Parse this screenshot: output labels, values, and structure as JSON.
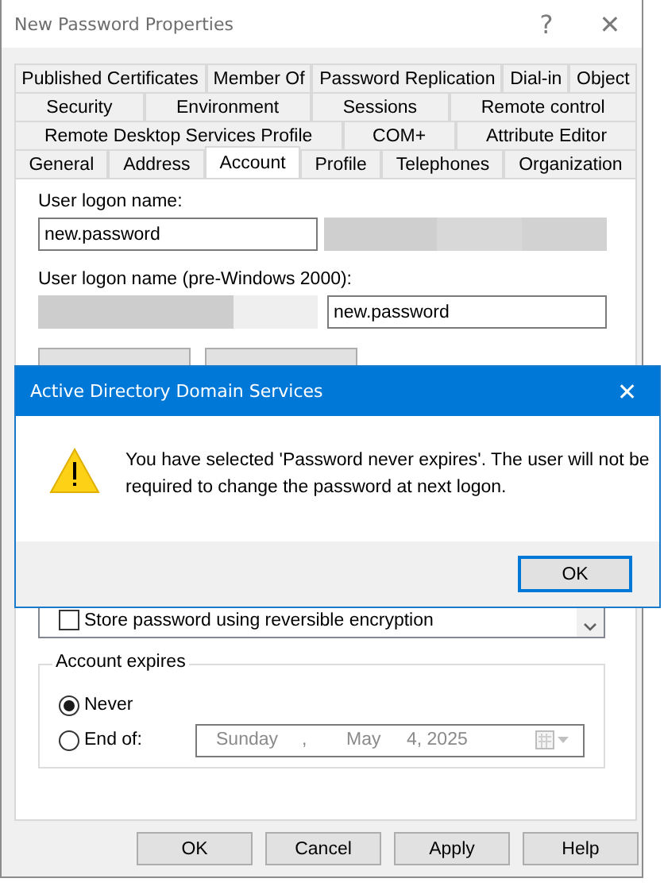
{
  "window": {
    "title": "New Password Properties",
    "help": "?",
    "close": "✕"
  },
  "tab_rows": [
    [
      {
        "label": "Published Certificates",
        "selected": false
      },
      {
        "label": "Member Of",
        "selected": false
      },
      {
        "label": "Password Replication",
        "selected": false
      },
      {
        "label": "Dial-in",
        "selected": false
      },
      {
        "label": "Object",
        "selected": false
      }
    ],
    [
      {
        "label": "Security",
        "selected": false
      },
      {
        "label": "Environment",
        "selected": false
      },
      {
        "label": "Sessions",
        "selected": false
      },
      {
        "label": "Remote control",
        "selected": false
      }
    ],
    [
      {
        "label": "Remote Desktop Services Profile",
        "selected": false
      },
      {
        "label": "COM+",
        "selected": false
      },
      {
        "label": "Attribute Editor",
        "selected": false
      }
    ],
    [
      {
        "label": "General",
        "selected": false
      },
      {
        "label": "Address",
        "selected": false
      },
      {
        "label": "Account",
        "selected": true
      },
      {
        "label": "Profile",
        "selected": false
      },
      {
        "label": "Telephones",
        "selected": false
      },
      {
        "label": "Organization",
        "selected": false
      }
    ]
  ],
  "account": {
    "logon_name_label": "User logon name:",
    "logon_name": "new.password",
    "pre2000_label": "User logon name (pre-Windows 2000):",
    "pre2000_name": "new.password",
    "account_options": [
      {
        "label": "Store password using reversible encryption",
        "checked": false
      }
    ],
    "expires_label": "Account expires",
    "expires": [
      {
        "label": "Never",
        "selected": true
      },
      {
        "label": "End of:",
        "selected": false
      }
    ],
    "date_picker": {
      "weekday": "Sunday",
      "separator": ",",
      "month": "May",
      "day_year": "4, 2025",
      "disabled": true
    }
  },
  "buttons": [
    "OK",
    "Cancel",
    "Apply",
    "Help"
  ],
  "message_box": {
    "title": "Active Directory Domain Services",
    "close": "✕",
    "message": "You have selected 'Password never expires'. The user will not be required to change the password at next logon.",
    "button": "OK"
  }
}
